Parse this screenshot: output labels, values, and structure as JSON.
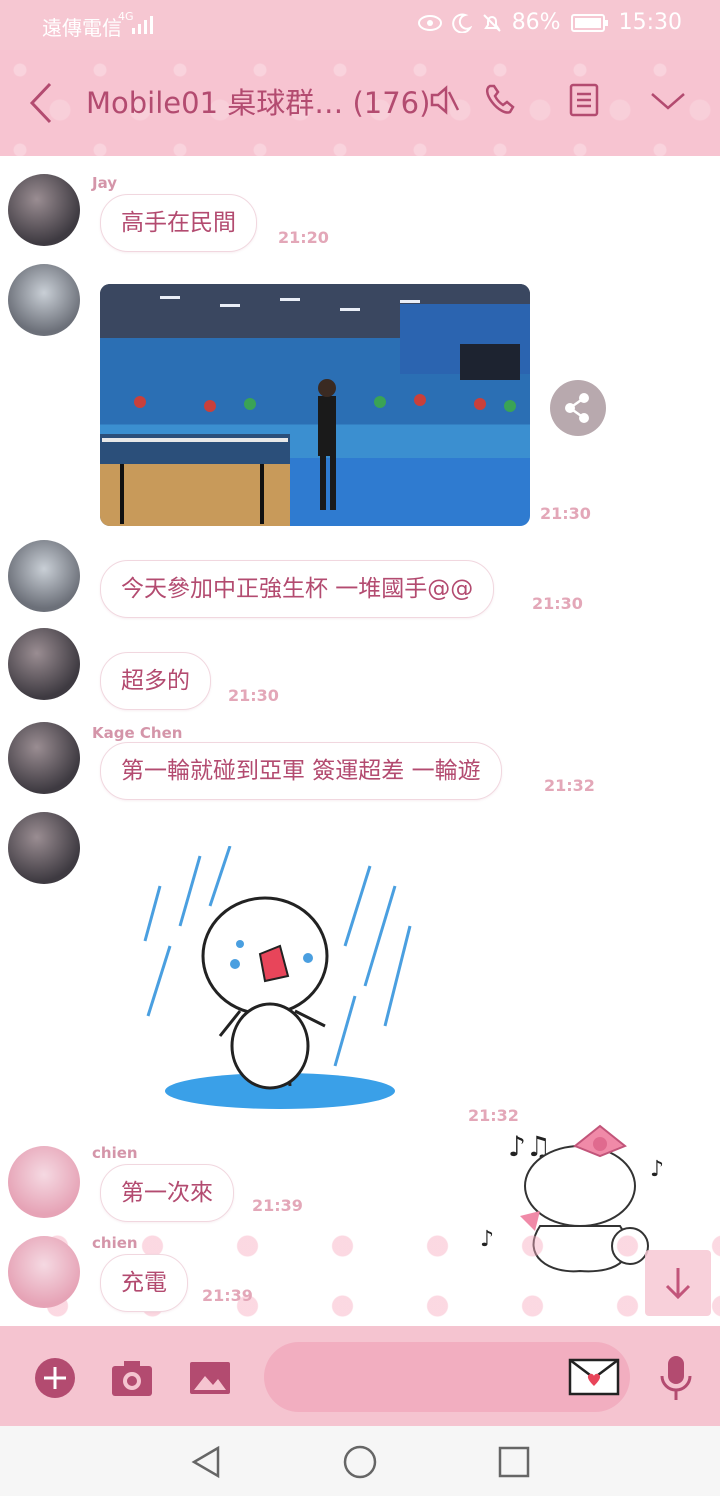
{
  "status_bar": {
    "carrier": "遠傳電信",
    "network": "4G",
    "battery": "86%",
    "time": "15:30"
  },
  "header": {
    "title": "Mobile01 桌球群…",
    "member_count": "(176)",
    "icons": [
      "back-icon",
      "mute-icon",
      "phone-icon",
      "notes-icon",
      "chevron-down-icon"
    ]
  },
  "messages": [
    {
      "name": "Jay",
      "text": "高手在民間",
      "time": "21:20"
    },
    {
      "name": "",
      "type": "photo",
      "time": "21:30"
    },
    {
      "name": "",
      "text": "今天參加中正強生杯 一堆國手@@",
      "time": "21:30"
    },
    {
      "name": "",
      "text": "超多的",
      "time": "21:30"
    },
    {
      "name": "Kage Chen",
      "text": "第一輪就碰到亞軍 簽運超差 一輪遊",
      "time": "21:32"
    },
    {
      "name": "",
      "type": "sticker",
      "time": "21:32"
    },
    {
      "name": "chien",
      "text": "第一次來",
      "time": "21:39"
    },
    {
      "name": "chien",
      "text": "充電",
      "time": "21:39"
    }
  ],
  "input_bar": {
    "icons": [
      "plus-icon",
      "camera-icon",
      "image-icon",
      "letter-icon",
      "mic-icon"
    ],
    "placeholder": ""
  },
  "colors": {
    "accent": "#b34b70",
    "header_bg": "#f7c4d1",
    "name_color": "#d495a9",
    "time_color": "#e3a7b8"
  }
}
